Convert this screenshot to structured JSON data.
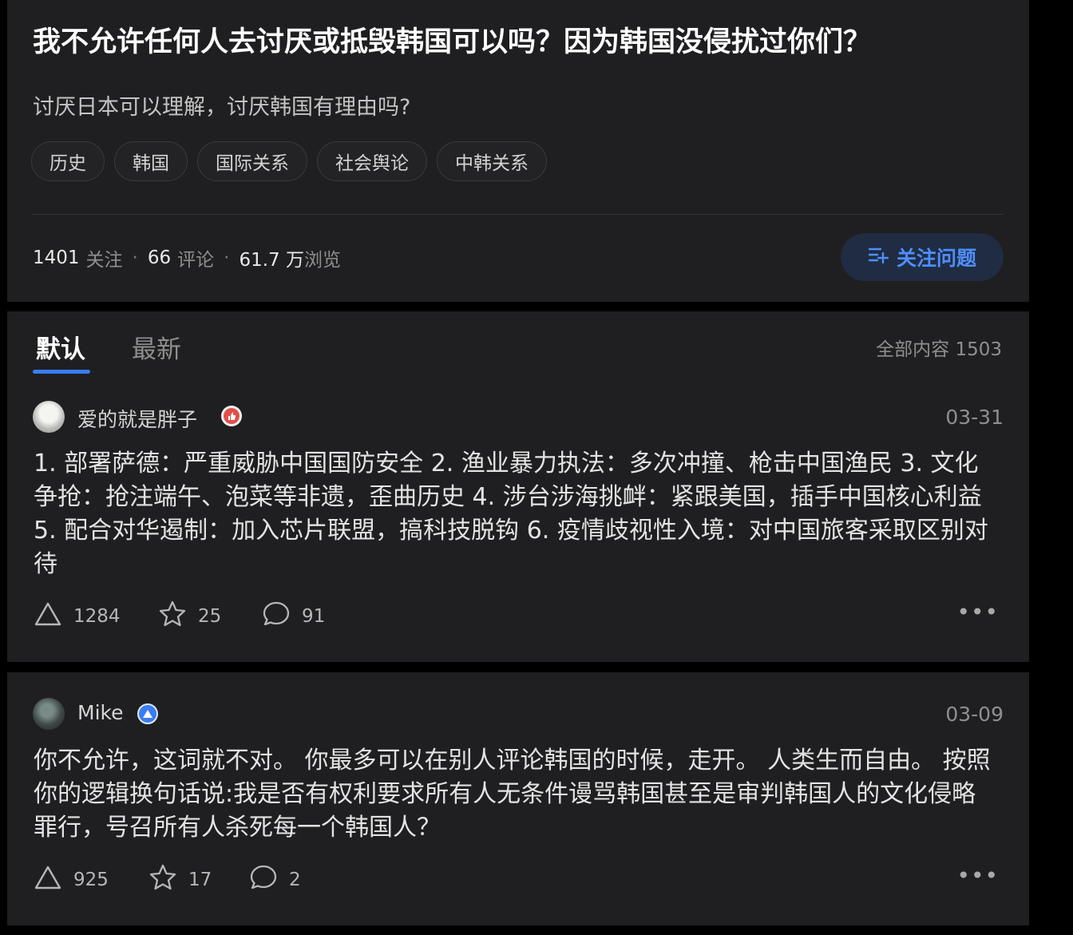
{
  "question": {
    "title": "我不允许任何人去讨厌或抵毁韩国可以吗？因为韩国没侵扰过你们？",
    "subtitle": "讨厌日本可以理解，讨厌韩国有理由吗?",
    "tags": [
      "历史",
      "韩国",
      "国际关系",
      "社会舆论",
      "中韩关系"
    ],
    "stats": {
      "followers": "1401",
      "followers_label": "关注",
      "comments": "66",
      "comments_label": "评论",
      "views": "61.7 万",
      "views_label": "浏览"
    },
    "follow_button": "关注问题"
  },
  "tabs": {
    "default": "默认",
    "latest": "最新",
    "total": "全部内容 1503"
  },
  "answers": [
    {
      "author": "爱的就是胖子",
      "date": "03-31",
      "content": "1. 部署萨德：严重威胁中国国防安全 2. 渔业暴力执法：多次冲撞、枪击中国渔民 3. 文化争抢：抢注端午、泡菜等非遗，歪曲历史 4. 涉台涉海挑衅：紧跟美国，插手中国核心利益 5. 配合对华遏制：加入芯片联盟，搞科技脱钩 6. 疫情歧视性入境：对中国旅客采取区别对待",
      "likes": "1284",
      "favorites": "25",
      "comments": "91"
    },
    {
      "author": "Mike",
      "date": "03-09",
      "content": "你不允许，这词就不对。  你最多可以在别人评论韩国的时候，走开。  人类生而自由。  按照你的逻辑换句话说:我是否有权利要求所有人无条件谩骂韩国甚至是审判韩国人的文化侵略罪行，号召所有人杀死每一个韩国人？",
      "likes": "925",
      "favorites": "17",
      "comments": "2"
    }
  ],
  "colors": {
    "background": "#000000",
    "card": "#1f1f21",
    "accent": "#3a7cf2",
    "follow_button_bg": "#1f2c42"
  },
  "icons": [
    "follow-list-icon",
    "upvote-icon",
    "star-icon",
    "comment-icon",
    "more-icon",
    "badge-icon",
    "avatar"
  ]
}
